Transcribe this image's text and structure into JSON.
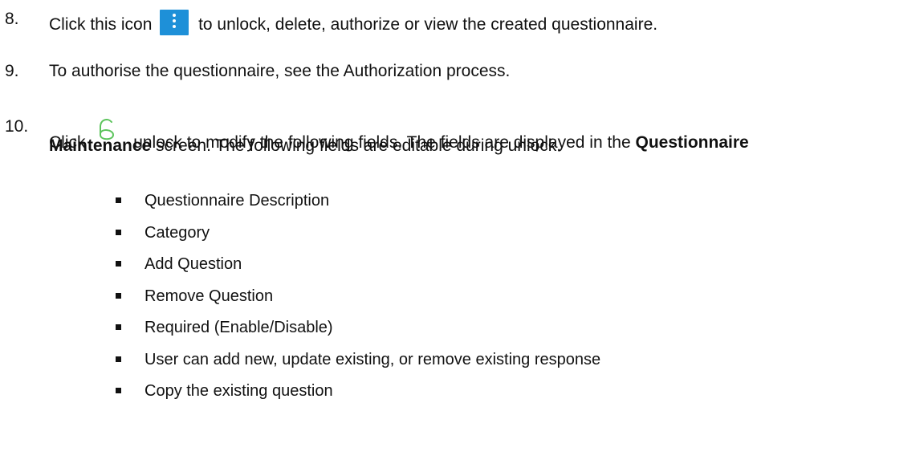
{
  "step8": {
    "number": "8.",
    "before_icon": "Click this icon",
    "icon": "more-options-icon",
    "after_icon": "to unlock, delete, authorize or view the created questionnaire."
  },
  "step9": {
    "number": "9.",
    "text": "To authorise the questionnaire, see the Authorization process."
  },
  "step10": {
    "number": "10.",
    "before_icon": "Click",
    "icon": "unlock-icon",
    "after_icon": "unlock to modify the following fields. The fields are displayed in the",
    "bold_1": "Questionnaire",
    "bold_2": "Maintenance",
    "after_bold": "screen. The following fields are editable during unlock."
  },
  "bullets": [
    "Questionnaire Description",
    "Category",
    "Add Question",
    "Remove Question",
    "Required (Enable/Disable)",
    "User can add new, update existing, or remove existing response",
    "Copy the existing question"
  ],
  "colors": {
    "icon_blue": "#1e90d8",
    "unlock_green": "#5cc45c",
    "text": "#111111"
  }
}
